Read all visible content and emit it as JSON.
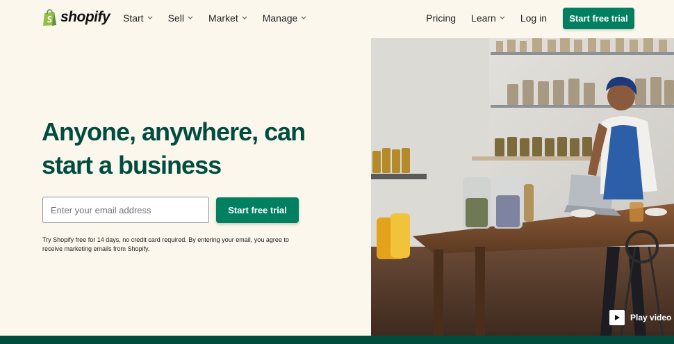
{
  "nav": {
    "logo_text": "shopify",
    "left_items": [
      {
        "label": "Start"
      },
      {
        "label": "Sell"
      },
      {
        "label": "Market"
      },
      {
        "label": "Manage"
      }
    ],
    "right_items": {
      "pricing": "Pricing",
      "learn": "Learn",
      "login": "Log in"
    },
    "cta_label": "Start free trial"
  },
  "hero": {
    "headline_line1": "Anyone, anywhere, can",
    "headline_line2": "start a business",
    "email_placeholder": "Enter your email address",
    "cta_label": "Start free trial",
    "disclaimer": "Try Shopify free for 14 days, no credit card required. By entering your email, you agree to receive marketing emails from Shopify.",
    "play_label": "Play video"
  },
  "colors": {
    "brand_green": "#008060",
    "headline_green": "#004c3f",
    "background": "#fbf7ed"
  }
}
